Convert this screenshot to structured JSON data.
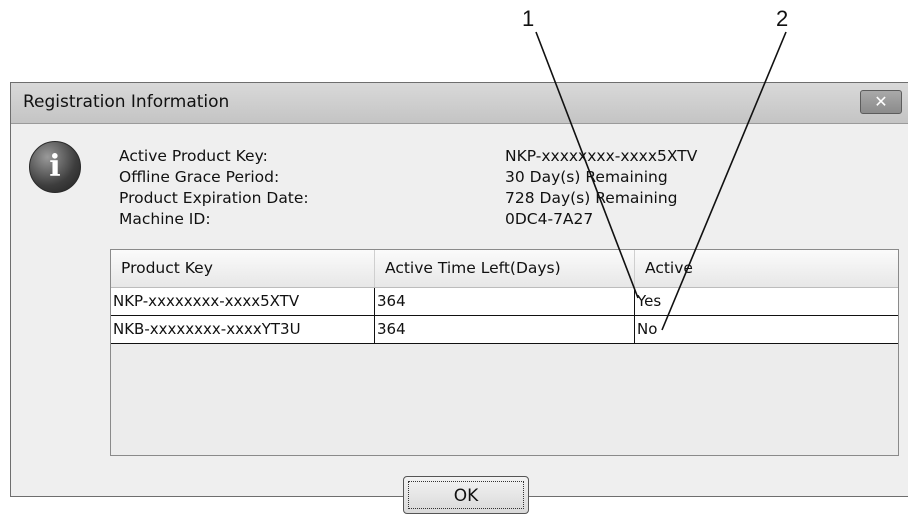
{
  "callouts": [
    "1",
    "2"
  ],
  "window": {
    "title": "Registration Information",
    "close_label": "✕"
  },
  "info_icon": "information-icon",
  "details": {
    "labels": [
      "Active Product Key:",
      "Offline Grace Period:",
      "Product Expiration Date:",
      "Machine ID:"
    ],
    "values": [
      "NKP-xxxxxxxx-xxxx5XTV",
      "30 Day(s) Remaining",
      "728 Day(s) Remaining",
      "0DC4-7A27"
    ]
  },
  "table": {
    "columns": [
      "Product Key",
      "Active Time Left(Days)",
      "Active"
    ],
    "rows": [
      [
        "NKP-xxxxxxxx-xxxx5XTV",
        "364",
        "Yes"
      ],
      [
        "NKB-xxxxxxxx-xxxxYT3U",
        "364",
        "No"
      ]
    ]
  },
  "ok_label": "OK"
}
